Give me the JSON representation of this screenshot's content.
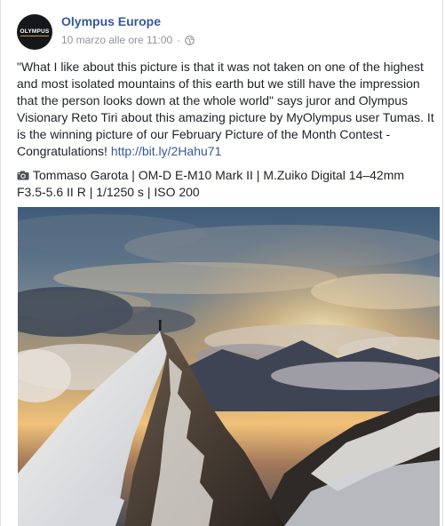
{
  "post": {
    "author": "Olympus Europe",
    "avatar_logo_text": "OLYMPUS",
    "timestamp": "10 marzo alle ore 11:00",
    "separator": "·",
    "privacy_icon": "globe-icon",
    "text_main": "\"What I like about this picture is that it was not taken on one of the highest and most isolated mountains of this earth but we still have the impression that the person looks down at the whole world\" says juror and Olympus Visionary Reto Tiri about this amazing picture by MyOlympus user Tumas. It is the winning picture of our February Picture of the Month Contest - Congratulations!",
    "link": "http://bit.ly/2Hahu71",
    "camera_icon": "camera-icon",
    "camera_info": "Tommaso Garota | OM-D E-M10 Mark II | M.Zuiko Digital 14–42mm F3.5-5.6 II R | 1/1250 s | ISO 200",
    "photo_subject": "snowy-mountain-ridge-sunset-photo"
  },
  "colors": {
    "link": "#365899",
    "meta": "#90949c",
    "text": "#1d2129",
    "border": "#dddfe2"
  }
}
